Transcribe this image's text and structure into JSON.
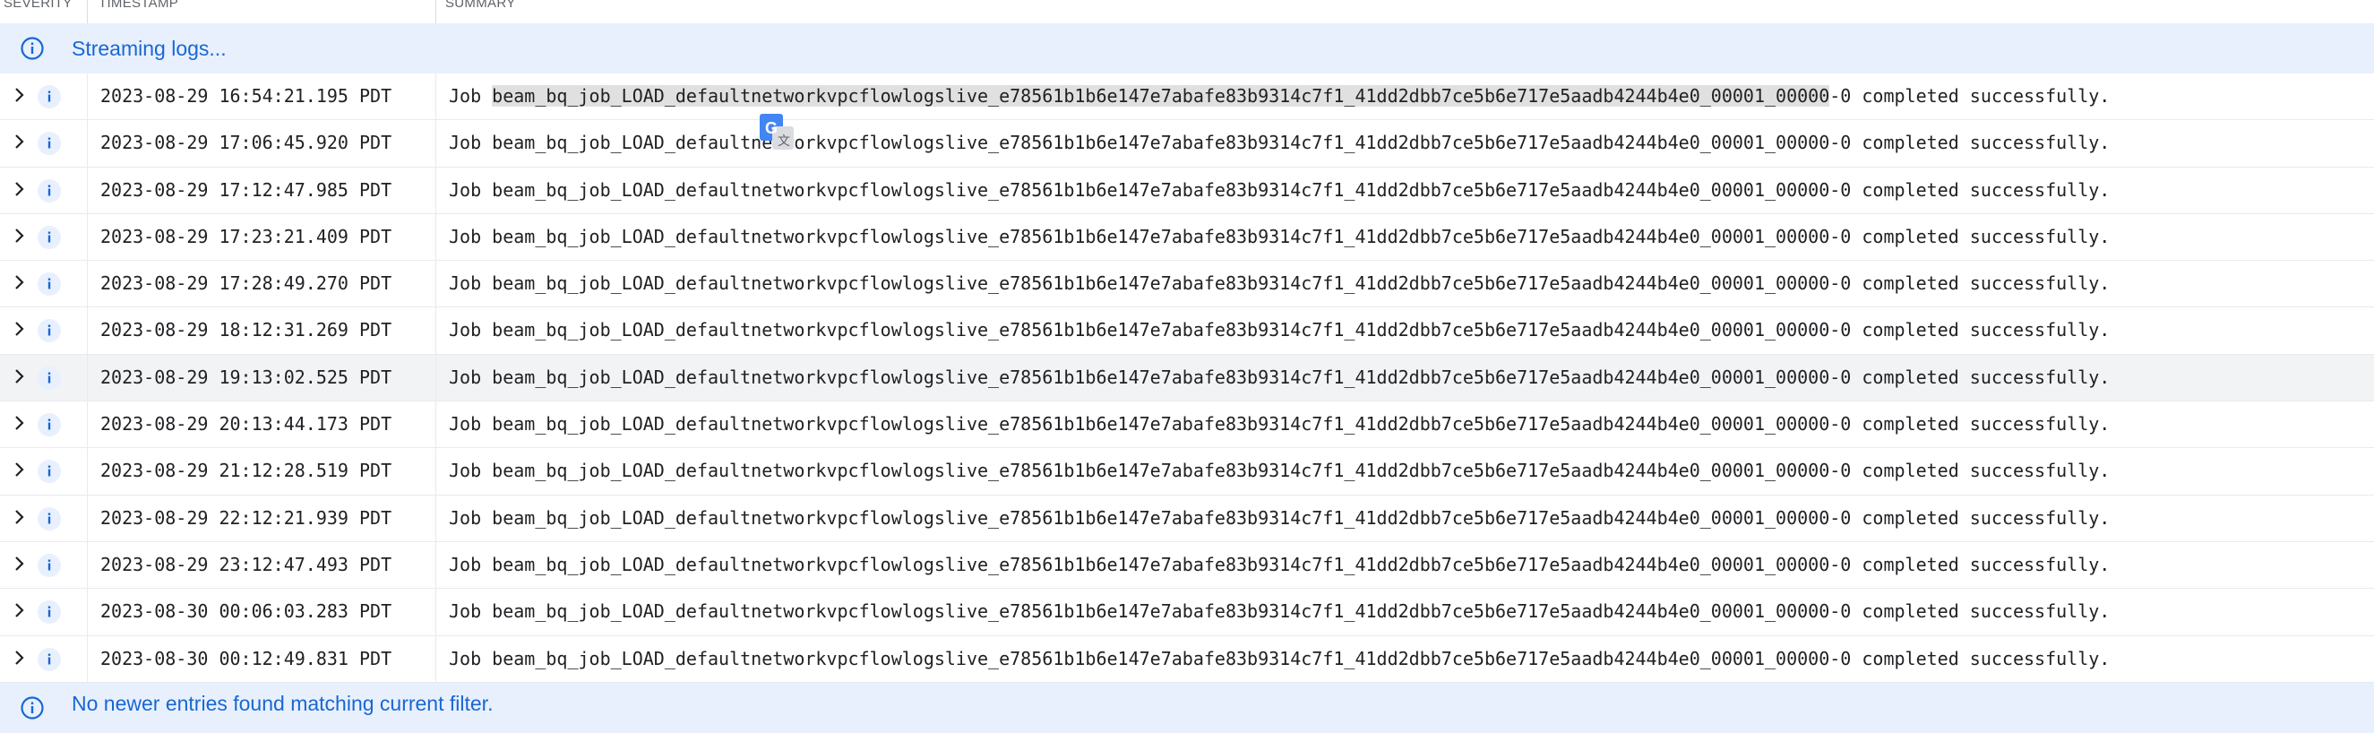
{
  "header": {
    "col_severity": "SEVERITY",
    "col_timestamp": "TIMESTAMP",
    "col_summary": "SUMMARY"
  },
  "top_banner": {
    "text": "Streaming logs...",
    "icon": "info-icon"
  },
  "bottom_banner": {
    "text": "No newer entries found matching current filter.",
    "icon": "info-icon"
  },
  "colors": {
    "info_blue": "#1967d2",
    "banner_bg": "#e8f0fe",
    "row_highlight": "#f1f3f4"
  },
  "logs": [
    {
      "timestamp": "2023-08-29 16:54:21.195 PDT",
      "prefix": "Job ",
      "job_id": "beam_bq_job_LOAD_defaultnetworkvpcflowlogslive_e78561b1b6e147e7abafe83b9314c7f1_41dd2dbb7ce5b6e717e5aadb4244b4e0_00001_00000",
      "suffix": "-0 completed successfully."
    },
    {
      "timestamp": "2023-08-29 17:06:45.920 PDT",
      "prefix": "Job ",
      "job_id": "beam_bq_job_LOAD_defaultnetworkvpcflowlogslive_e78561b1b6e147e7abafe83b9314c7f1_41dd2dbb7ce5b6e717e5aadb4244b4e0_00001_00000",
      "suffix": "-0 completed successfully."
    },
    {
      "timestamp": "2023-08-29 17:12:47.985 PDT",
      "prefix": "Job ",
      "job_id": "beam_bq_job_LOAD_defaultnetworkvpcflowlogslive_e78561b1b6e147e7abafe83b9314c7f1_41dd2dbb7ce5b6e717e5aadb4244b4e0_00001_00000",
      "suffix": "-0 completed successfully."
    },
    {
      "timestamp": "2023-08-29 17:23:21.409 PDT",
      "prefix": "Job ",
      "job_id": "beam_bq_job_LOAD_defaultnetworkvpcflowlogslive_e78561b1b6e147e7abafe83b9314c7f1_41dd2dbb7ce5b6e717e5aadb4244b4e0_00001_00000",
      "suffix": "-0 completed successfully."
    },
    {
      "timestamp": "2023-08-29 17:28:49.270 PDT",
      "prefix": "Job ",
      "job_id": "beam_bq_job_LOAD_defaultnetworkvpcflowlogslive_e78561b1b6e147e7abafe83b9314c7f1_41dd2dbb7ce5b6e717e5aadb4244b4e0_00001_00000",
      "suffix": "-0 completed successfully."
    },
    {
      "timestamp": "2023-08-29 18:12:31.269 PDT",
      "prefix": "Job ",
      "job_id": "beam_bq_job_LOAD_defaultnetworkvpcflowlogslive_e78561b1b6e147e7abafe83b9314c7f1_41dd2dbb7ce5b6e717e5aadb4244b4e0_00001_00000",
      "suffix": "-0 completed successfully."
    },
    {
      "timestamp": "2023-08-29 19:13:02.525 PDT",
      "prefix": "Job ",
      "job_id": "beam_bq_job_LOAD_defaultnetworkvpcflowlogslive_e78561b1b6e147e7abafe83b9314c7f1_41dd2dbb7ce5b6e717e5aadb4244b4e0_00001_00000",
      "suffix": "-0 completed successfully."
    },
    {
      "timestamp": "2023-08-29 20:13:44.173 PDT",
      "prefix": "Job ",
      "job_id": "beam_bq_job_LOAD_defaultnetworkvpcflowlogslive_e78561b1b6e147e7abafe83b9314c7f1_41dd2dbb7ce5b6e717e5aadb4244b4e0_00001_00000",
      "suffix": "-0 completed successfully."
    },
    {
      "timestamp": "2023-08-29 21:12:28.519 PDT",
      "prefix": "Job ",
      "job_id": "beam_bq_job_LOAD_defaultnetworkvpcflowlogslive_e78561b1b6e147e7abafe83b9314c7f1_41dd2dbb7ce5b6e717e5aadb4244b4e0_00001_00000",
      "suffix": "-0 completed successfully."
    },
    {
      "timestamp": "2023-08-29 22:12:21.939 PDT",
      "prefix": "Job ",
      "job_id": "beam_bq_job_LOAD_defaultnetworkvpcflowlogslive_e78561b1b6e147e7abafe83b9314c7f1_41dd2dbb7ce5b6e717e5aadb4244b4e0_00001_00000",
      "suffix": "-0 completed successfully."
    },
    {
      "timestamp": "2023-08-29 23:12:47.493 PDT",
      "prefix": "Job ",
      "job_id": "beam_bq_job_LOAD_defaultnetworkvpcflowlogslive_e78561b1b6e147e7abafe83b9314c7f1_41dd2dbb7ce5b6e717e5aadb4244b4e0_00001_00000",
      "suffix": "-0 completed successfully."
    },
    {
      "timestamp": "2023-08-30 00:06:03.283 PDT",
      "prefix": "Job ",
      "job_id": "beam_bq_job_LOAD_defaultnetworkvpcflowlogslive_e78561b1b6e147e7abafe83b9314c7f1_41dd2dbb7ce5b6e717e5aadb4244b4e0_00001_00000",
      "suffix": "-0 completed successfully."
    },
    {
      "timestamp": "2023-08-30 00:12:49.831 PDT",
      "prefix": "Job ",
      "job_id": "beam_bq_job_LOAD_defaultnetworkvpcflowlogslive_e78561b1b6e147e7abafe83b9314c7f1_41dd2dbb7ce5b6e717e5aadb4244b4e0_00001_00000",
      "suffix": "-0 completed successfully."
    }
  ]
}
